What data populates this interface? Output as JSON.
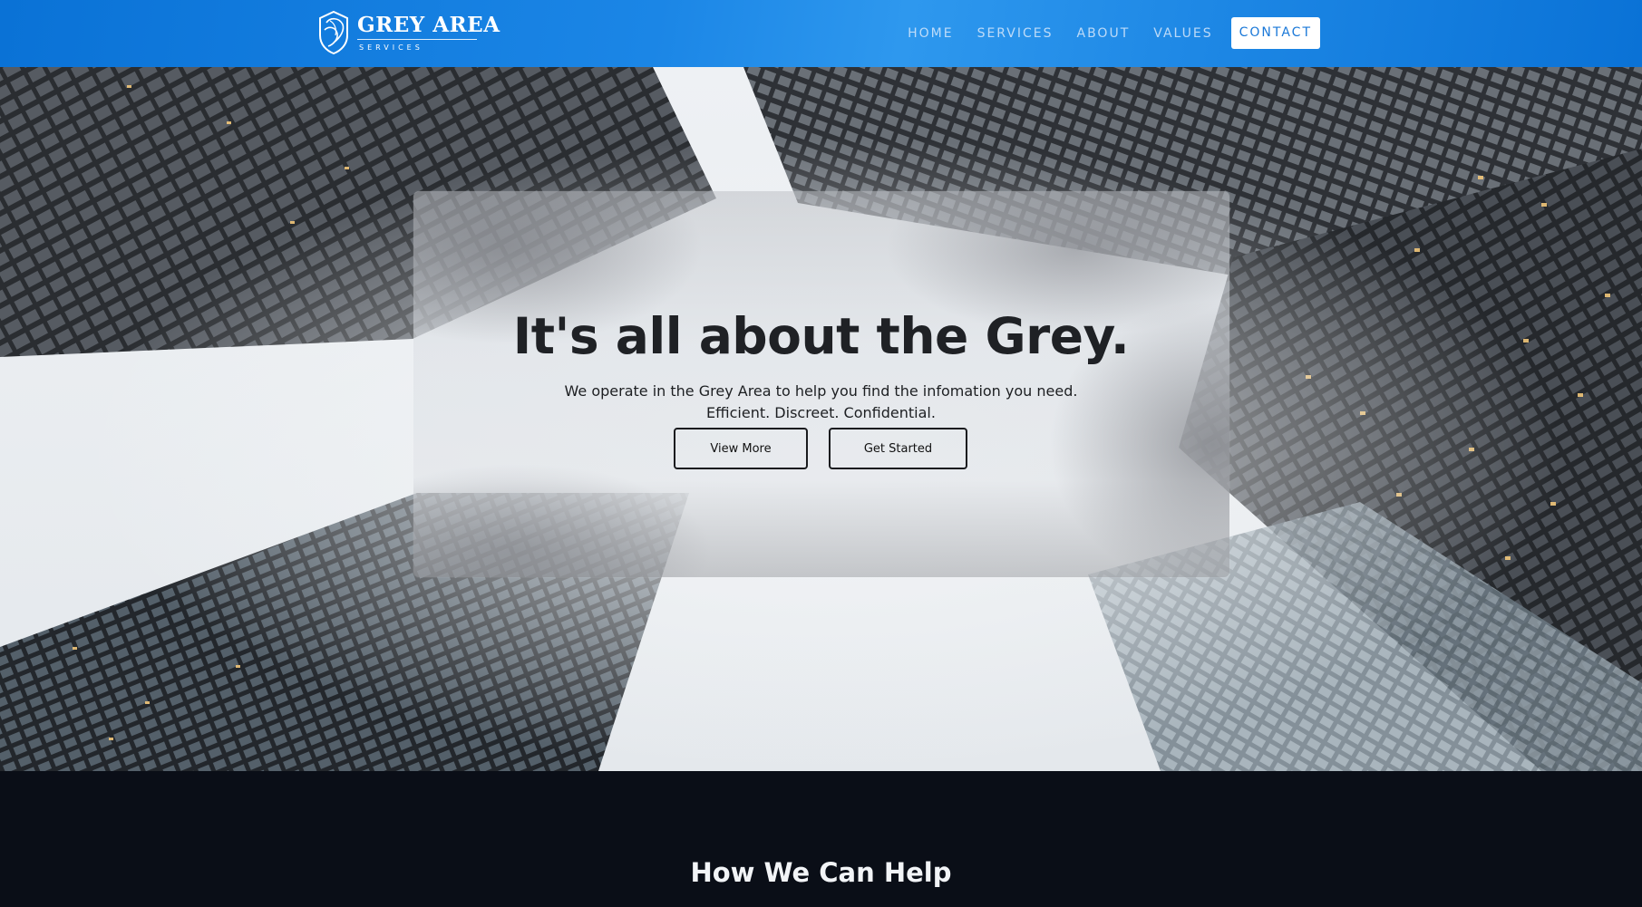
{
  "brand": {
    "name": "GREY AREA",
    "tagline": "SERVICES"
  },
  "nav": {
    "items": [
      "HOME",
      "SERVICES",
      "ABOUT",
      "VALUES"
    ],
    "cta": "CONTACT"
  },
  "hero": {
    "title": "It's all about the Grey.",
    "subtitle_line1": "We operate in the Grey Area to help you find the infomation you need.",
    "subtitle_line2": "Efficient. Discreet. Confidential.",
    "primary_button": "View More",
    "secondary_button": "Get Started"
  },
  "section": {
    "title": "How We Can Help"
  },
  "colors": {
    "nav_blue": "#1a80e0",
    "dark_bg": "#0a0e17",
    "text_dark": "#1f2125"
  }
}
